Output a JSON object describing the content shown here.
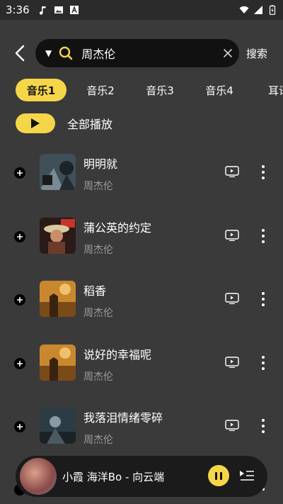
{
  "status_bar": {
    "time": "3:36"
  },
  "search": {
    "query": "周杰伦",
    "submit_label": "搜索"
  },
  "tabs": [
    {
      "label": "音乐1",
      "active": true
    },
    {
      "label": "音乐2",
      "active": false
    },
    {
      "label": "音乐3",
      "active": false
    },
    {
      "label": "音乐4",
      "active": false
    },
    {
      "label": "耳语",
      "active": false
    }
  ],
  "play_all": {
    "label": "全部播放"
  },
  "songs": [
    {
      "title": "明明就",
      "artist": "周杰伦"
    },
    {
      "title": "蒲公英的约定",
      "artist": "周杰伦"
    },
    {
      "title": "稻香",
      "artist": "周杰伦"
    },
    {
      "title": "说好的幸福呢",
      "artist": "周杰伦"
    },
    {
      "title": "我落泪情绪零碎",
      "artist": "周杰伦"
    }
  ],
  "now_playing": {
    "title": "小霞 海洋Bo - 向云端"
  },
  "colors": {
    "accent": "#f5d649",
    "background": "#3a3a3a",
    "search_bg": "#111111",
    "secondary_text": "#9a9a9a"
  }
}
